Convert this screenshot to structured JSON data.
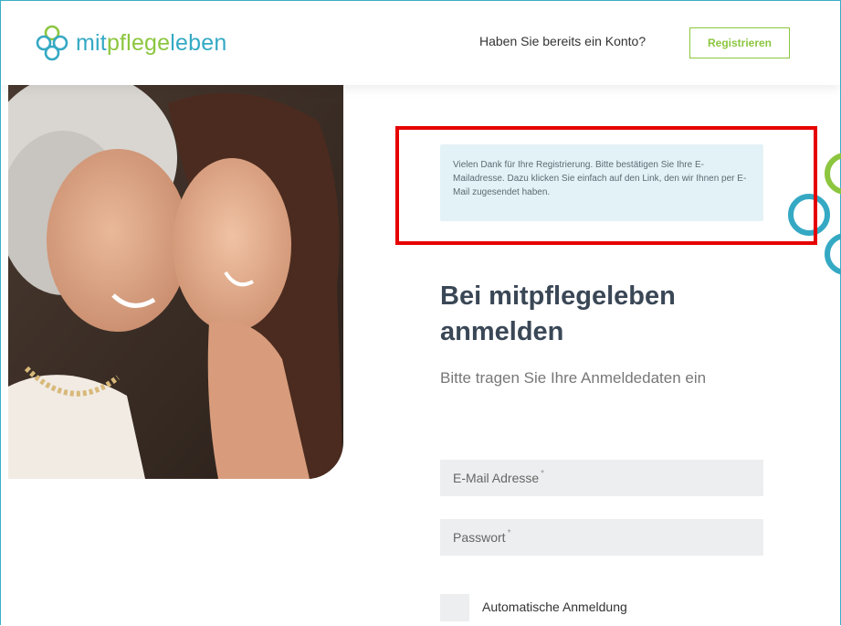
{
  "header": {
    "logo_part1": "mit",
    "logo_part2": "pflege",
    "logo_part3": "leben",
    "account_question": "Haben Sie bereits ein Konto?",
    "register_label": "Registrieren"
  },
  "notice": {
    "text": "Vielen Dank für Ihre Registrierung. Bitte bestätigen Sie Ihre E-Mailadresse. Dazu klicken Sie einfach auf den Link, den wir Ihnen per E-Mail zugesendet haben."
  },
  "login": {
    "title": "Bei mitpflegeleben anmelden",
    "subtitle": "Bitte tragen Sie Ihre Anmeldedaten ein",
    "email_placeholder": "E-Mail Adresse",
    "password_placeholder": "Passwort",
    "required_mark": "*",
    "auto_login_label": "Automatische Anmeldung"
  },
  "colors": {
    "brand_blue": "#35a9c4",
    "brand_green": "#8cc63f",
    "notice_bg": "#e3f2f6",
    "highlight_red": "#e60000"
  },
  "icons": [
    "logo-knot-icon",
    "decorative-knot-icon"
  ]
}
